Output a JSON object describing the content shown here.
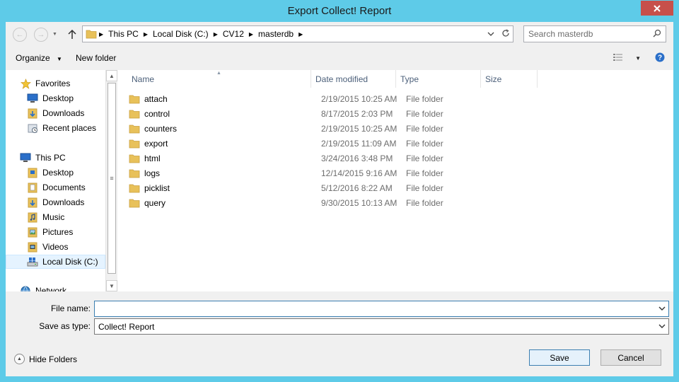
{
  "window": {
    "title": "Export Collect! Report"
  },
  "address_bar": {
    "breadcrumbs": [
      "This PC",
      "Local Disk (C:)",
      "CV12",
      "masterdb"
    ]
  },
  "search": {
    "placeholder": "Search masterdb"
  },
  "toolbar": {
    "organize_label": "Organize",
    "new_folder_label": "New folder"
  },
  "nav_pane": {
    "favorites_label": "Favorites",
    "favorites": [
      "Desktop",
      "Downloads",
      "Recent places"
    ],
    "this_pc_label": "This PC",
    "this_pc_items": [
      "Desktop",
      "Documents",
      "Downloads",
      "Music",
      "Pictures",
      "Videos",
      "Local Disk (C:)"
    ],
    "network_label": "Network"
  },
  "file_list": {
    "columns": [
      "Name",
      "Date modified",
      "Type",
      "Size"
    ],
    "rows": [
      {
        "name": "attach",
        "date": "2/19/2015 10:25 AM",
        "type": "File folder"
      },
      {
        "name": "control",
        "date": "8/17/2015 2:03 PM",
        "type": "File folder"
      },
      {
        "name": "counters",
        "date": "2/19/2015 10:25 AM",
        "type": "File folder"
      },
      {
        "name": "export",
        "date": "2/19/2015 11:09 AM",
        "type": "File folder"
      },
      {
        "name": "html",
        "date": "3/24/2016 3:48 PM",
        "type": "File folder"
      },
      {
        "name": "logs",
        "date": "12/14/2015 9:16 AM",
        "type": "File folder"
      },
      {
        "name": "picklist",
        "date": "5/12/2016 8:22 AM",
        "type": "File folder"
      },
      {
        "name": "query",
        "date": "9/30/2015 10:13 AM",
        "type": "File folder"
      }
    ]
  },
  "form": {
    "file_name_label": "File name:",
    "file_name_value": "",
    "save_as_type_label": "Save as type:",
    "save_as_type_value": "Collect! Report"
  },
  "footer": {
    "hide_folders_label": "Hide Folders",
    "save_label": "Save",
    "cancel_label": "Cancel"
  },
  "colors": {
    "frame": "#5ecbe8",
    "close_button": "#c7504b",
    "folder": "#e8c15a",
    "header_text": "#4c607a"
  }
}
